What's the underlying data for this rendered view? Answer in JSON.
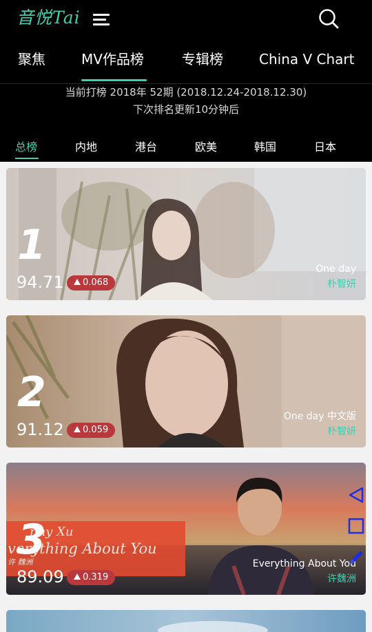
{
  "header": {
    "logo_text": "音悦Tai",
    "nav": [
      "聚焦",
      "MV作品榜",
      "专辑榜",
      "China V Chart"
    ],
    "active_nav": "MV作品榜"
  },
  "chart_info": {
    "period": "当前打榜 2018年 52期 (2018.12.24-2018.12.30)",
    "next_update": "下次排名更新10分钟后"
  },
  "region_tabs": [
    "总榜",
    "内地",
    "港台",
    "欧美",
    "韩国",
    "日本"
  ],
  "active_region": "总榜",
  "entries": [
    {
      "rank": "1",
      "score": "94.71",
      "delta": "0.068",
      "song": "One day",
      "artist": "朴智妍"
    },
    {
      "rank": "2",
      "score": "91.12",
      "delta": "0.059",
      "song": "One day 中文版",
      "artist": "朴智妍"
    },
    {
      "rank": "3",
      "score": "89.09",
      "delta": "0.319",
      "song": "Everything About You",
      "artist": "许魏洲",
      "banner_line1": "nny Xu",
      "banner_line2": "verything About You",
      "banner_line3": "许 魏洲"
    }
  ],
  "colors": {
    "accent": "#3ecfb0",
    "delta_badge": "#b8383b",
    "floating_controls": "#1f2fe0"
  }
}
